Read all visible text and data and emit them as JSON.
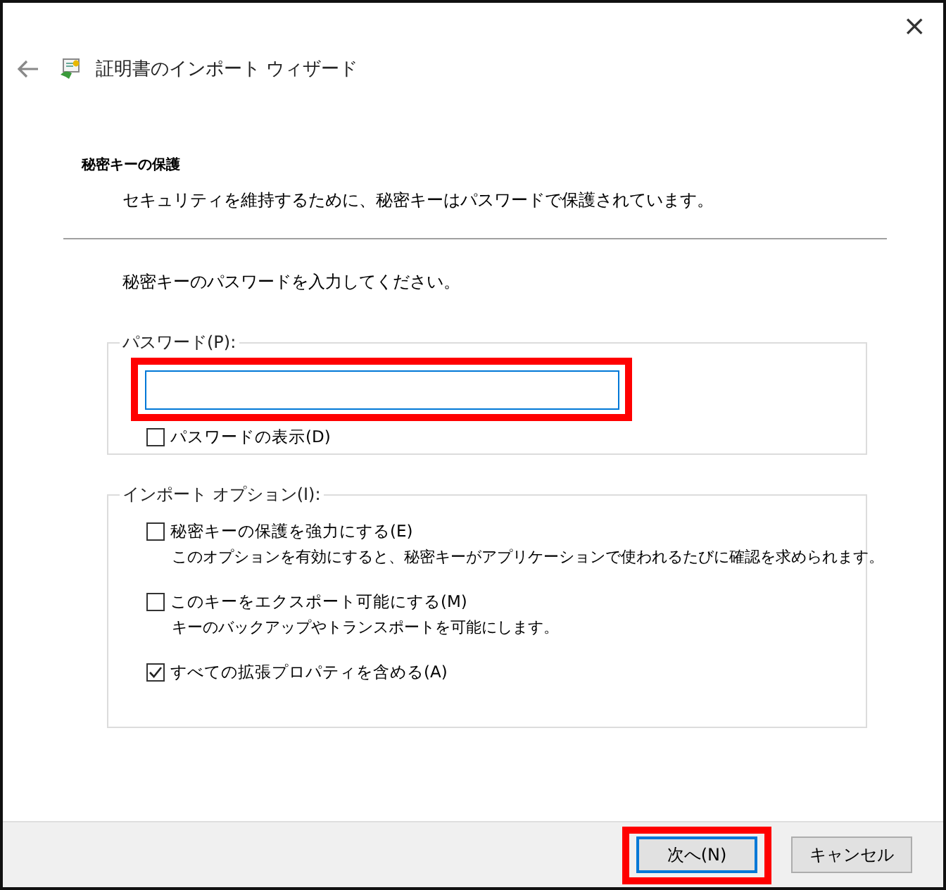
{
  "window": {
    "close_icon": "×",
    "title": "証明書のインポート ウィザード"
  },
  "header": {
    "heading": "秘密キーの保護",
    "description": "セキュリティを維持するために、秘密キーはパスワードで保護されています。"
  },
  "instruction": "秘密キーのパスワードを入力してください。",
  "password_group": {
    "legend": "パスワード(P):",
    "field": {
      "focused": true,
      "highlighted": true
    },
    "show_password": {
      "label": "パスワードの表示(D)",
      "checked": false
    }
  },
  "options_group": {
    "legend": "インポート オプション(I):",
    "options": [
      {
        "label": "秘密キーの保護を強力にする(E)",
        "description": "このオプションを有効にすると、秘密キーがアプリケーションで使われるたびに確認を求められます。",
        "checked": false
      },
      {
        "label": "このキーをエクスポート可能にする(M)",
        "description": "キーのバックアップやトランスポートを可能にします。",
        "checked": false
      },
      {
        "label": "すべての拡張プロパティを含める(A)",
        "checked": true
      }
    ]
  },
  "buttons": [
    {
      "label": "次へ(N)",
      "default": true,
      "highlighted": true
    },
    {
      "label": "キャンセル",
      "default": false,
      "highlighted": false
    }
  ]
}
